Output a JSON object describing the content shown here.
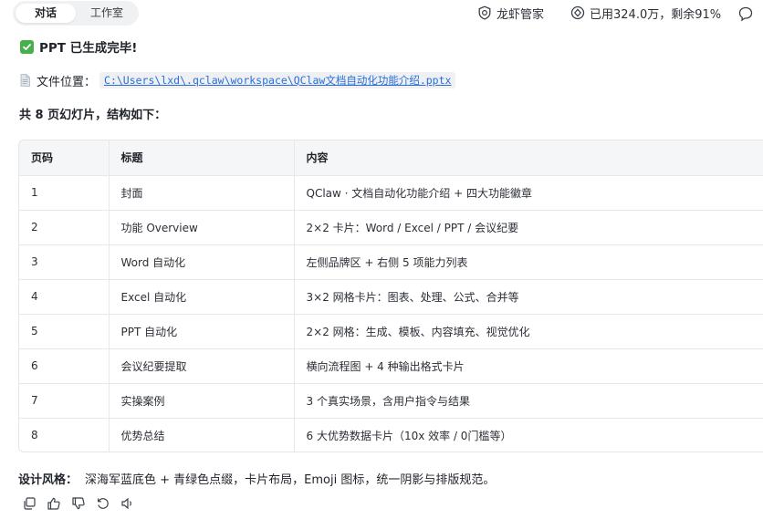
{
  "tabs": [
    {
      "label": "对话"
    },
    {
      "label": "工作室"
    }
  ],
  "status": {
    "brand": "龙虾管家",
    "quota": "已用324.0万，剩余91%"
  },
  "message": {
    "heading": "PPT 已生成完毕!",
    "file_label": "文件位置：",
    "file_path": "C:\\Users\\lxd\\.qclaw\\workspace\\QClaw文档自动化功能介绍.pptx",
    "summary": "共 8 页幻灯片，结构如下：",
    "table": {
      "headers": [
        "页码",
        "标题",
        "内容"
      ],
      "rows": [
        [
          "1",
          "封面",
          "QClaw · 文档自动化功能介绍 + 四大功能徽章"
        ],
        [
          "2",
          "功能 Overview",
          "2×2 卡片：Word / Excel / PPT / 会议纪要"
        ],
        [
          "3",
          "Word 自动化",
          "左侧品牌区 + 右侧 5 项能力列表"
        ],
        [
          "4",
          "Excel 自动化",
          "3×2 网格卡片：图表、处理、公式、合并等"
        ],
        [
          "5",
          "PPT 自动化",
          "2×2 网格：生成、模板、内容填充、视觉优化"
        ],
        [
          "6",
          "会议纪要提取",
          "横向流程图 + 4 种输出格式卡片"
        ],
        [
          "7",
          "实操案例",
          "3 个真实场景，含用户指令与结果"
        ],
        [
          "8",
          "优势总结",
          "6 大优势数据卡片（10x 效率 / 0门槛等）"
        ]
      ]
    },
    "design_label": "设计风格：",
    "design_text": "深海军蓝底色 + 青绿色点缀，卡片布局，Emoji 图标，统一阴影与排版规范。"
  },
  "icons": {
    "brand": "shield-icon",
    "quota": "token-quota-icon",
    "more": "chat-bubble-icon",
    "actions": [
      "copy-icon",
      "thumbs-up-icon",
      "thumbs-down-icon",
      "retry-icon",
      "volume-icon"
    ]
  },
  "colors": {
    "link": "#2b6fd6",
    "check": "#47b04b"
  }
}
